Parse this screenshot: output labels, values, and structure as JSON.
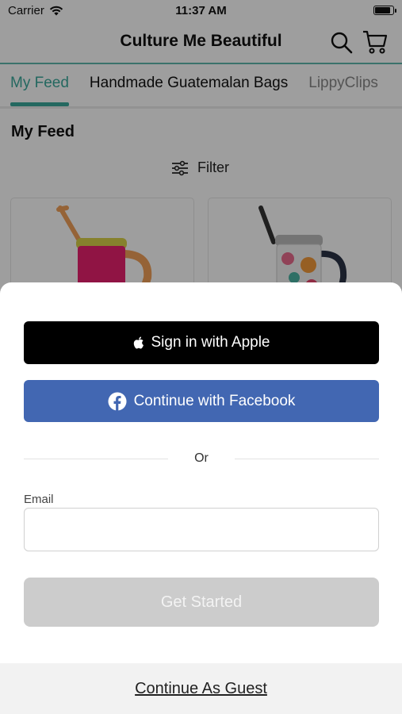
{
  "status_bar": {
    "carrier": "Carrier",
    "time": "11:37 AM",
    "battery_level": 0.9
  },
  "navbar": {
    "title": "Culture Me Beautiful",
    "search_icon": "search-icon",
    "cart_icon": "cart-icon"
  },
  "tabs": [
    {
      "label": "My Feed",
      "active": true
    },
    {
      "label": "Handmade Guatemalan Bags",
      "active": false
    },
    {
      "label": "LippyClips",
      "active": false
    }
  ],
  "feed": {
    "title": "My Feed",
    "filter_label": "Filter",
    "products": [
      {
        "name": "pink-mug",
        "color": "#e8216f"
      },
      {
        "name": "floral-mug",
        "color": "#f2f2f2"
      }
    ]
  },
  "signin_sheet": {
    "apple_label": "Sign in with Apple",
    "facebook_label": "Continue with Facebook",
    "or_label": "Or",
    "email_label": "Email",
    "email_value": "",
    "email_placeholder": "",
    "get_started_label": "Get Started",
    "guest_label": "Continue As Guest"
  },
  "colors": {
    "accent": "#3aa99b",
    "apple": "#000000",
    "facebook": "#4267b2",
    "disabled_button": "#cccccc"
  }
}
